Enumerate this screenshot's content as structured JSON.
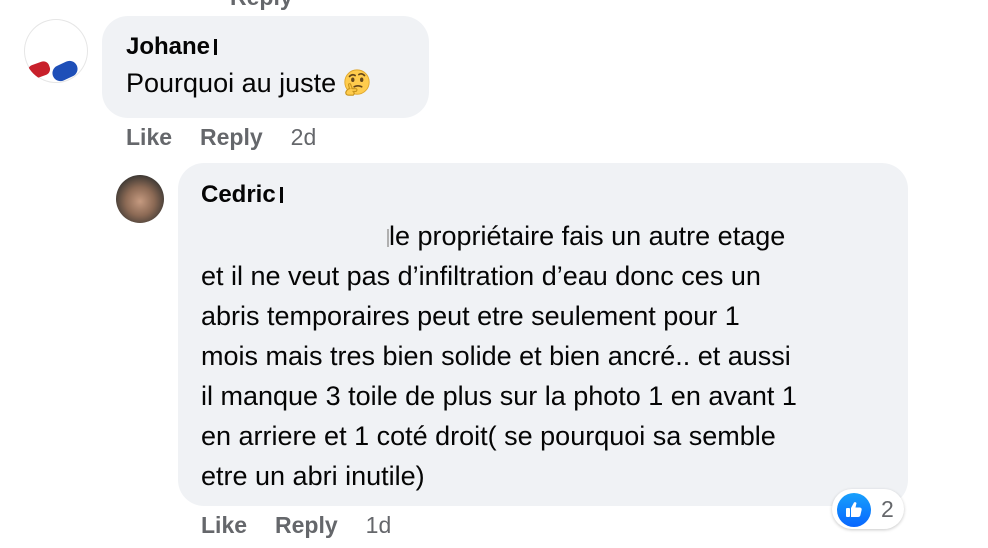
{
  "top_fragment": {
    "label": "Reply"
  },
  "comments": [
    {
      "author": "Johane",
      "text": "Pourquoi au juste",
      "emoji": "thinking-face",
      "actions": {
        "like": "Like",
        "reply": "Reply",
        "time": "2d"
      }
    },
    {
      "author": "Cedric",
      "text_lines": [
        "le propriétaire fais un autre etage",
        "et il ne veut pas d’infiltration d’eau donc ces un",
        "abris temporaires peut etre seulement pour 1",
        "mois mais tres bien solide et bien ancré.. et aussi",
        "il manque 3 toile de plus sur la photo 1 en avant 1",
        "en arriere et 1 coté droit( se pourquoi sa semble",
        "etre un abri inutile)"
      ],
      "reactions": {
        "icon": "thumbs-up-icon",
        "count": "2",
        "color": "#0866ff"
      },
      "actions": {
        "like": "Like",
        "reply": "Reply",
        "time": "1d"
      }
    }
  ]
}
